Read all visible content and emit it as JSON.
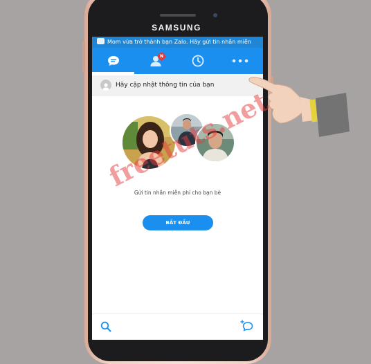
{
  "device": {
    "brand": "SAMSUNG"
  },
  "notification": {
    "icon": "chat-icon",
    "text": "Mom vừa trở thành bạn Zalo. Hãy gửi tin nhắn miễn"
  },
  "tabs": [
    {
      "icon": "chat-bubble-icon",
      "active": true
    },
    {
      "icon": "contacts-icon",
      "badge": "N"
    },
    {
      "icon": "clock-icon"
    },
    {
      "icon": "more-icon"
    }
  ],
  "update_prompt": {
    "text": "Hãy cập nhật thông tin của bạn"
  },
  "main": {
    "caption": "Gửi tin nhắn miễn phí cho bạn bè",
    "start_button": "BẮT ĐẦU"
  },
  "bottom_bar": {
    "left_icon": "search-icon",
    "right_icon": "new-chat-icon"
  },
  "watermark": "freetuts.net",
  "colors": {
    "accent": "#1a8ff0",
    "badge": "#e33a3a"
  }
}
